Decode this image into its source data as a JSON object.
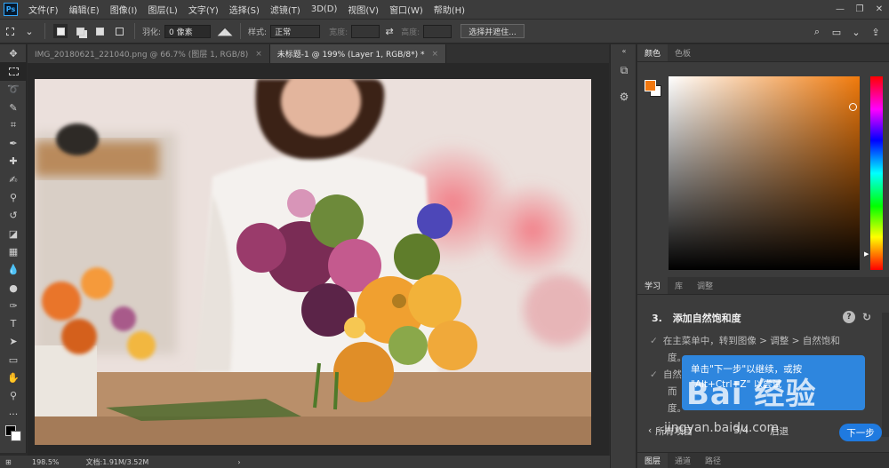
{
  "app": {
    "logo": "Ps"
  },
  "menu": [
    "文件(F)",
    "编辑(E)",
    "图像(I)",
    "图层(L)",
    "文字(Y)",
    "选择(S)",
    "滤镜(T)",
    "3D(D)",
    "视图(V)",
    "窗口(W)",
    "帮助(H)"
  ],
  "window_controls": {
    "minimize": "—",
    "restore": "❐",
    "close": "✕"
  },
  "options": {
    "feather_label": "羽化:",
    "feather_value": "0 像素",
    "style_label": "样式:",
    "style_value": "正常",
    "width_label": "宽度:",
    "height_label": "高度:",
    "select_mask_btn": "选择并遮住..."
  },
  "doc_tabs": [
    {
      "label": "IMG_20180621_221040.png @ 66.7% (图层 1, RGB/8)",
      "close": "×"
    },
    {
      "label": "未标题-1 @ 199% (Layer 1, RGB/8*) *",
      "close": "×"
    }
  ],
  "status": {
    "zoom": "198.5%",
    "doc": "文档:1.91M/3.52M"
  },
  "color_panel": {
    "tabs": [
      "颜色",
      "色板"
    ],
    "foreground_color": "#f2780f",
    "background_color": "#ffffff"
  },
  "learn_panel": {
    "tabs": [
      "学习",
      "库",
      "调整"
    ],
    "step_number": "3.",
    "step_title": "添加自然饱和度",
    "lines": [
      "在主菜单中，转到图像 > 调整 > 自然饱和",
      "度。",
      "自然",
      "而",
      "度。"
    ],
    "tooltip_line1": "单击\"下一步\"以继续，或按",
    "tooltip_line2": "\"Alt+Ctrl+Z\" 以尝试",
    "all_projects": "所有项目",
    "progress": "3/4",
    "back": "后退",
    "next": "下一步",
    "watermark": "Bai 经验",
    "watermark_url": "jingyan.baidu.com"
  },
  "layers_panel": {
    "tabs": [
      "图层",
      "通道",
      "路径"
    ]
  }
}
